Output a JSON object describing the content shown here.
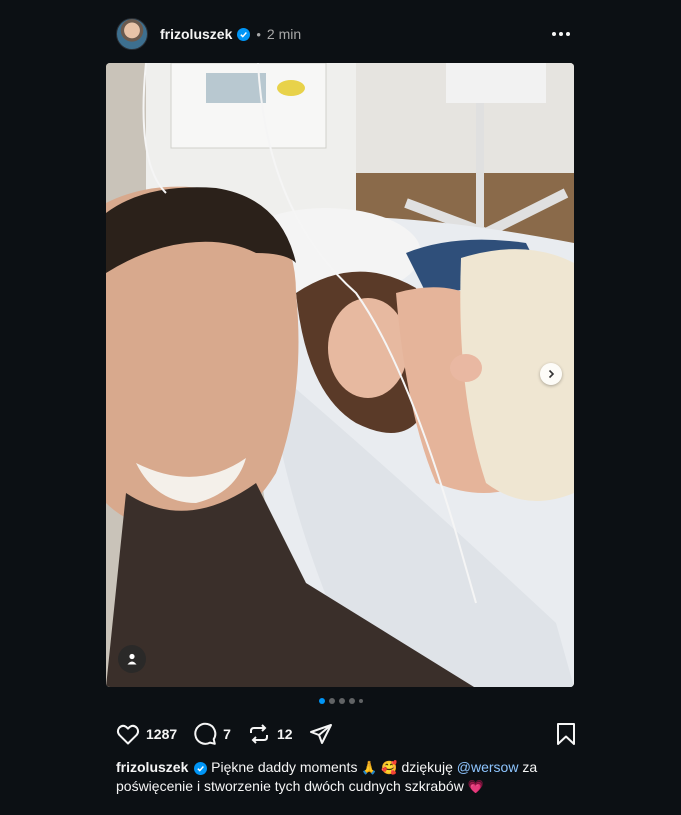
{
  "post": {
    "username": "frizoluszek",
    "separator": "•",
    "time": "2 min"
  },
  "carousel": {
    "slides": 5,
    "active_index": 0
  },
  "actions": {
    "likes": "1287",
    "comments": "7",
    "reposts": "12"
  },
  "caption": {
    "username": "frizoluszek",
    "text_1": "Piękne daddy moments",
    "emoji_1": "🙏",
    "emoji_2": "🥰",
    "text_2": "dziękuję",
    "mention": "@wersow",
    "text_3": "za poświęcenie i stworzenie tych dwóch cudnych szkrabów",
    "emoji_3": "💗"
  },
  "colors": {
    "background": "#0c1014",
    "verified": "#0095f6",
    "mention": "#8ec5ff",
    "active_dot": "#0095f6"
  },
  "icons": [
    "more-icon",
    "verified-icon",
    "heart-icon",
    "comment-icon",
    "repost-icon",
    "share-icon",
    "bookmark-icon",
    "chevron-right-icon",
    "user-tag-icon"
  ]
}
